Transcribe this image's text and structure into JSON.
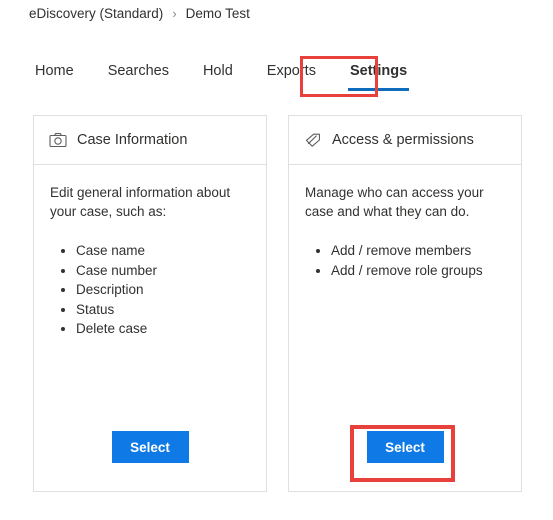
{
  "breadcrumb": {
    "parent": "eDiscovery (Standard)",
    "separator": "›",
    "current": "Demo Test"
  },
  "tabs": [
    {
      "label": "Home",
      "selected": false
    },
    {
      "label": "Searches",
      "selected": false
    },
    {
      "label": "Hold",
      "selected": false
    },
    {
      "label": "Exports",
      "selected": false
    },
    {
      "label": "Settings",
      "selected": true
    }
  ],
  "cards": [
    {
      "icon": "camera-icon",
      "title": "Case Information",
      "description": "Edit general information about your case, such as:",
      "items": [
        "Case name",
        "Case number",
        "Description",
        "Status",
        "Delete case"
      ],
      "button_label": "Select"
    },
    {
      "icon": "tag-icon",
      "title": "Access & permissions",
      "description": "Manage who can access your case and what they can do.",
      "items": [
        "Add / remove members",
        "Add / remove role groups"
      ],
      "button_label": "Select"
    }
  ],
  "annotations": {
    "highlight_color": "#e8403a",
    "settings_tab_highlight": "Settings",
    "select_button_highlight": "Select"
  },
  "colors": {
    "accent": "#0f7ae5",
    "tab_underline": "#0f6cbd",
    "card_border": "#e1dfdd",
    "text": "#323130"
  }
}
